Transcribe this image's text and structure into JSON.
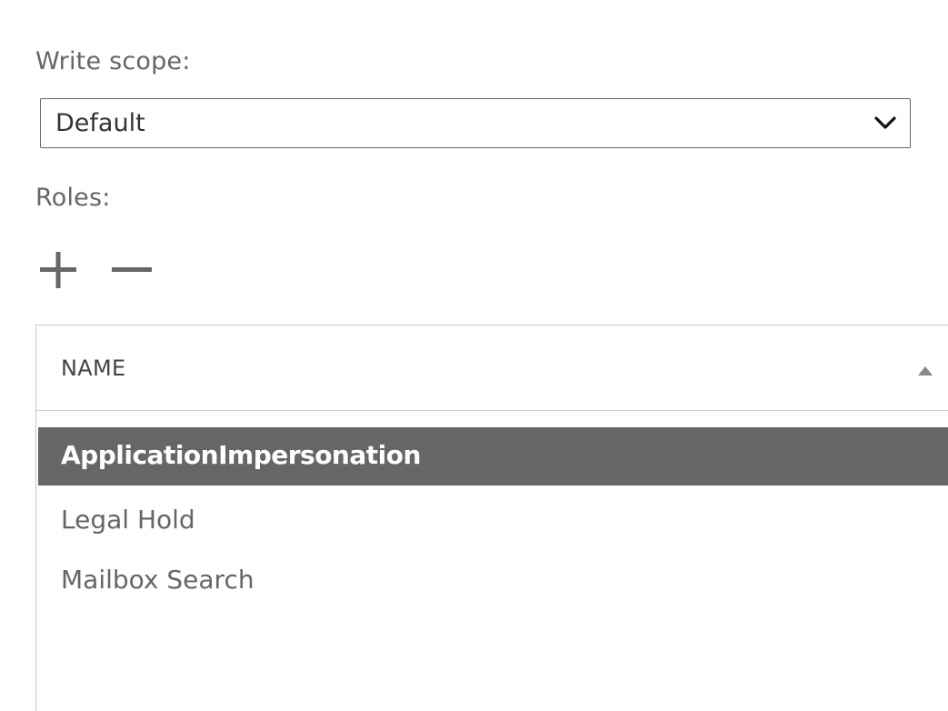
{
  "write_scope": {
    "label": "Write scope:",
    "selected": "Default",
    "chevron_icon": "chevron-down-icon"
  },
  "roles": {
    "label": "Roles:",
    "add_icon": "plus-icon",
    "remove_icon": "minus-icon",
    "table": {
      "column_header": "NAME",
      "sort_icon": "sort-ascending-icon",
      "rows": [
        {
          "name": "ApplicationImpersonation",
          "selected": true
        },
        {
          "name": "Legal Hold",
          "selected": false
        },
        {
          "name": "Mailbox Search",
          "selected": false
        }
      ]
    }
  },
  "colors": {
    "selected_row_bg": "#666666",
    "selected_row_text": "#ffffff",
    "text_muted": "#666666",
    "border": "#c8c8c8"
  }
}
